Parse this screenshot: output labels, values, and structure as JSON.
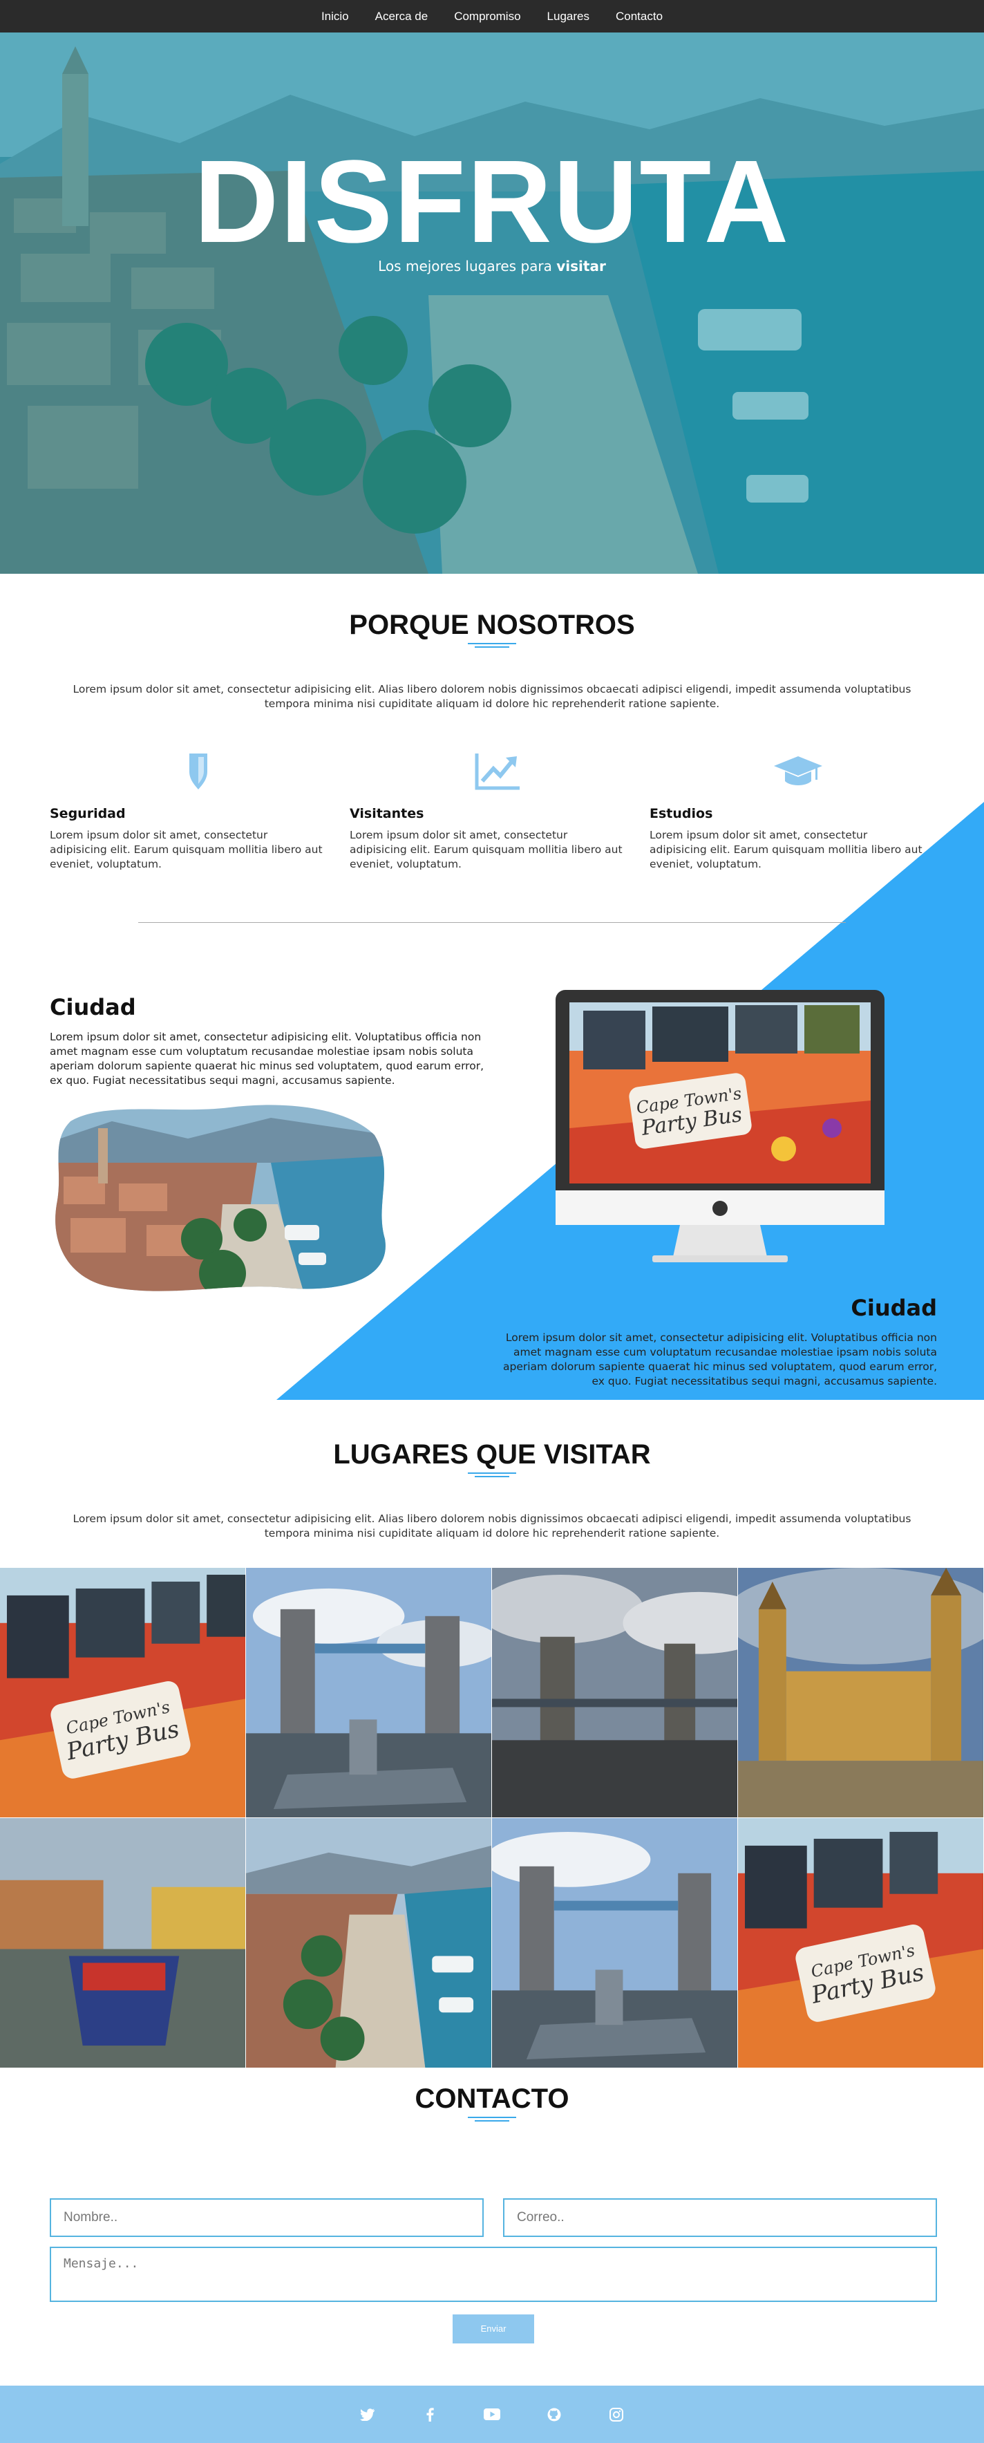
{
  "nav": {
    "items": [
      {
        "label": "Inicio"
      },
      {
        "label": "Acerca de"
      },
      {
        "label": "Compromiso"
      },
      {
        "label": "Lugares"
      },
      {
        "label": "Contacto"
      }
    ]
  },
  "hero": {
    "title": "DISFRUTA",
    "subtitle_prefix": "Los mejores lugares para ",
    "subtitle_bold": "visitar"
  },
  "why": {
    "title": "PORQUE NOSOTROS",
    "intro": "Lorem ipsum dolor sit amet, consectetur adipisicing elit. Alias libero dolorem nobis dignissimos obcaecati adipisci eligendi, impedit assumenda voluptatibus tempora minima nisi cupiditate aliquam id dolore hic reprehenderit ratione sapiente.",
    "features": [
      {
        "icon": "shield-icon",
        "title": "Seguridad",
        "text": "Lorem ipsum dolor sit amet, consectetur adipisicing elit. Earum quisquam mollitia libero aut eveniet, voluptatum."
      },
      {
        "icon": "chart-line-icon",
        "title": "Visitantes",
        "text": "Lorem ipsum dolor sit amet, consectetur adipisicing elit. Earum quisquam mollitia libero aut eveniet, voluptatum."
      },
      {
        "icon": "graduation-cap-icon",
        "title": "Estudios",
        "text": "Lorem ipsum dolor sit amet, consectetur adipisicing elit. Earum quisquam mollitia libero aut eveniet, voluptatum."
      }
    ]
  },
  "city": [
    {
      "title": "Ciudad",
      "text": "Lorem ipsum dolor sit amet, consectetur adipisicing elit. Voluptatibus officia non amet magnam esse cum voluptatum recusandae molestiae ipsam nobis soluta aperiam dolorum sapiente quaerat hic minus sed voluptatem, quod earum error, ex quo. Fugiat necessitatibus sequi magni, accusamus sapiente."
    },
    {
      "title": "Ciudad",
      "text": "Lorem ipsum dolor sit amet, consectetur adipisicing elit. Voluptatibus officia non amet magnam esse cum voluptatum recusandae molestiae ipsam nobis soluta aperiam dolorum sapiente quaerat hic minus sed voluptatem, quod earum error, ex quo. Fugiat necessitatibus sequi magni, accusamus sapiente."
    }
  ],
  "places": {
    "title": "LUGARES QUE VISITAR",
    "intro": "Lorem ipsum dolor sit amet, consectetur adipisicing elit. Alias libero dolorem nobis dignissimos obcaecati adipisci eligendi, impedit assumenda voluptatibus tempora minima nisi cupiditate aliquam id dolore hic reprehenderit ratione sapiente.",
    "bus_sign": "Cape Town's Party Bus"
  },
  "contact": {
    "title": "CONTACTO",
    "name_placeholder": "Nombre..",
    "email_placeholder": "Correo..",
    "message_placeholder": "Mensaje...",
    "send_label": "Enviar"
  },
  "footer": {
    "icons": [
      "twitter-icon",
      "facebook-icon",
      "youtube-icon",
      "github-icon",
      "instagram-icon"
    ]
  },
  "colors": {
    "accent": "#3aa9ea",
    "nav_bg": "#2b2b2b",
    "hero_tint": "#1b96aa",
    "diagonal": "#33aaf7",
    "footer_bg": "#8ec8ef"
  }
}
